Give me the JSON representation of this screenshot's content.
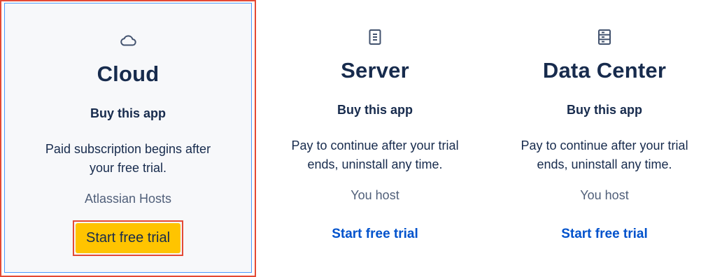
{
  "plans": [
    {
      "icon": "cloud-icon",
      "title": "Cloud",
      "buy_label": "Buy this app",
      "description_lines": [
        "Paid subscription begins after",
        "your free trial."
      ],
      "host": "Atlassian Hosts",
      "cta": "Start free trial",
      "selected": true
    },
    {
      "icon": "server-icon",
      "title": "Server",
      "buy_label": "Buy this app",
      "description_lines": [
        "Pay to continue after your trial",
        "ends, uninstall any time."
      ],
      "host": "You host",
      "cta": "Start free trial",
      "selected": false
    },
    {
      "icon": "data-center-icon",
      "title": "Data Center",
      "buy_label": "Buy this app",
      "description_lines": [
        "Pay to continue after your trial",
        "ends, uninstall any time."
      ],
      "host": "You host",
      "cta": "Start free trial",
      "selected": false
    }
  ],
  "colors": {
    "primary_button": "#ffc400",
    "link": "#0052cc",
    "highlight_border": "#e34935",
    "text": "#172b4d"
  }
}
